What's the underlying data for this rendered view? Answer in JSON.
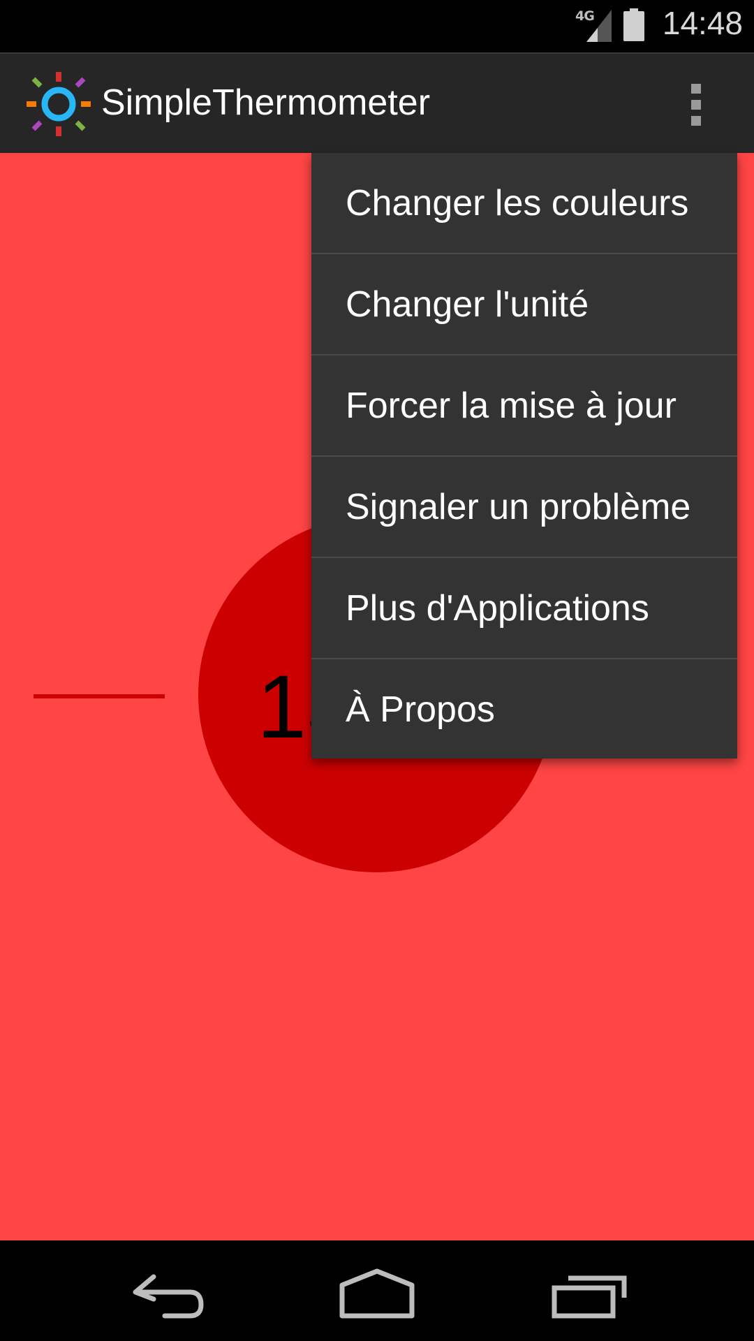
{
  "status_bar": {
    "network": "4G",
    "time": "14:48",
    "icons": [
      "signal-icon",
      "battery-icon"
    ]
  },
  "action_bar": {
    "title": "SimpleThermometer",
    "logo_icon": "sun-logo-icon",
    "overflow_icon": "overflow-menu-icon"
  },
  "content": {
    "temperature_visible": "13",
    "background_color": "#ff4545",
    "accent_color": "#cc0000"
  },
  "menu": {
    "items": [
      {
        "label": "Changer les couleurs"
      },
      {
        "label": "Changer l'unité"
      },
      {
        "label": "Forcer la mise à jour"
      },
      {
        "label": "Signaler un problème"
      },
      {
        "label": "Plus d'Applications"
      },
      {
        "label": "À Propos"
      }
    ]
  },
  "nav_bar": {
    "icons": [
      "back-icon",
      "home-icon",
      "recents-icon"
    ]
  }
}
